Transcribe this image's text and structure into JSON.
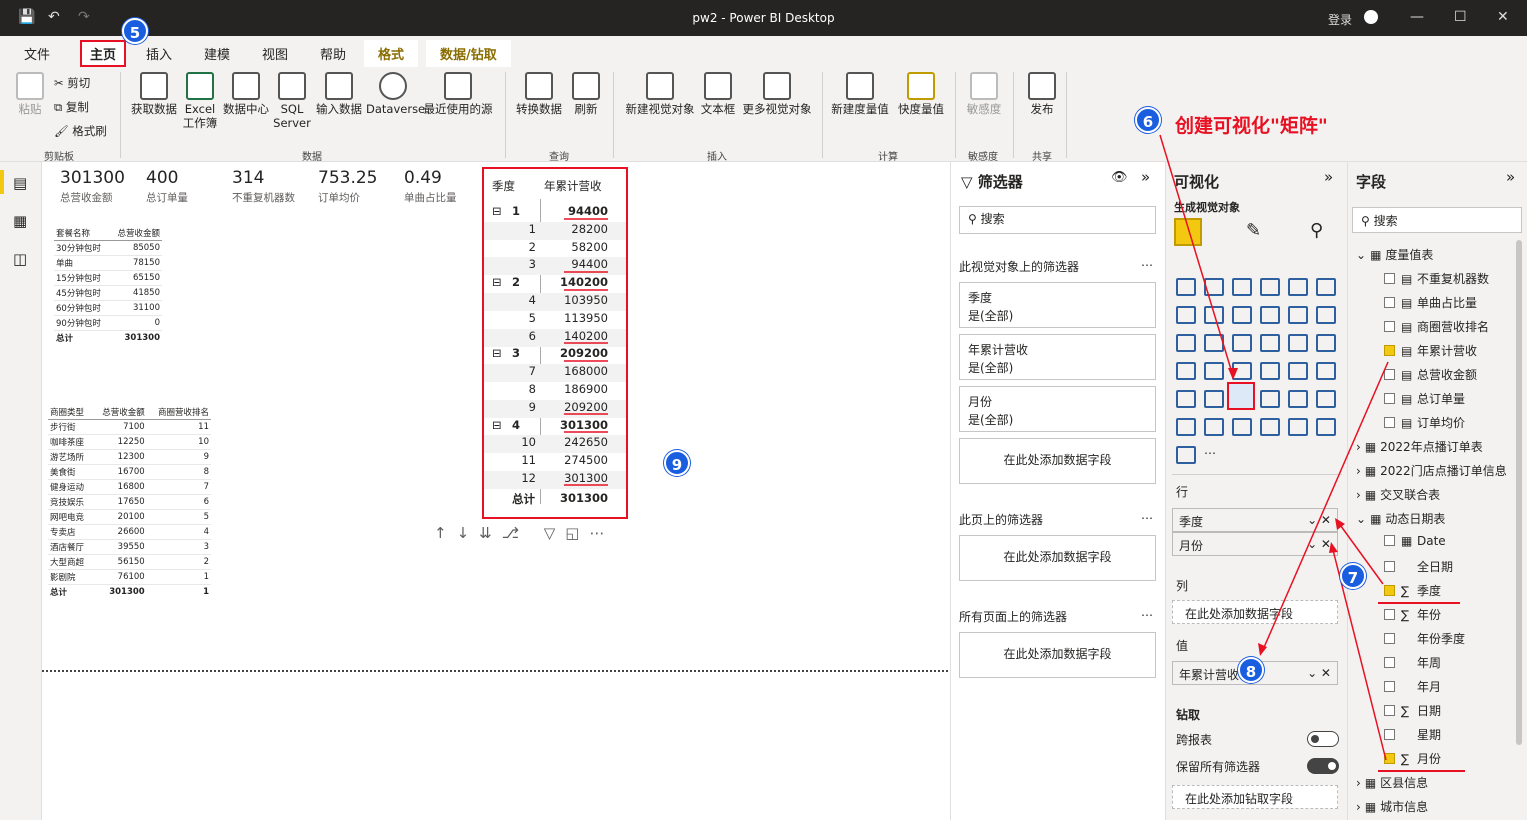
{
  "window": {
    "title": "pw2 - Power BI Desktop",
    "login": "登录"
  },
  "tabs": [
    "文件",
    "主页",
    "插入",
    "建模",
    "视图",
    "帮助",
    "格式",
    "数据/钻取"
  ],
  "ribbon": {
    "clipboard": {
      "paste": "粘贴",
      "cut": "剪切",
      "copy": "复制",
      "format_painter": "格式刷",
      "group": "剪贴板"
    },
    "data": {
      "get_data": "获取数据",
      "excel": "Excel 工作簿",
      "data_hub": "数据中心",
      "sql": "SQL Server",
      "enter_data": "输入数据",
      "dataverse": "Dataverse",
      "recent": "最近使用的源",
      "group": "数据"
    },
    "query": {
      "transform": "转换数据",
      "refresh": "刷新",
      "group": "查询"
    },
    "insert": {
      "new_visual": "新建视觉对象",
      "textbox": "文本框",
      "more_visuals": "更多视觉对象",
      "group": "插入"
    },
    "calc": {
      "new_measure": "新建度量值",
      "quick_measure": "快度量值",
      "group": "计算"
    },
    "sensitivity": {
      "label": "敏感度",
      "group": "敏感度"
    },
    "share": {
      "publish": "发布",
      "group": "共享"
    }
  },
  "cards": [
    {
      "value": "301300",
      "label": "总营收金额"
    },
    {
      "value": "400",
      "label": "总订单量"
    },
    {
      "value": "314",
      "label": "不重复机器数"
    },
    {
      "value": "753.25",
      "label": "订单均价"
    },
    {
      "value": "0.49",
      "label": "单曲占比量"
    }
  ],
  "table1": {
    "headers": [
      "套餐名称",
      "总营收金额"
    ],
    "rows": [
      [
        "30分钟包时",
        "85050"
      ],
      [
        "单曲",
        "78150"
      ],
      [
        "15分钟包时",
        "65150"
      ],
      [
        "45分钟包时",
        "41850"
      ],
      [
        "60分钟包时",
        "31100"
      ],
      [
        "90分钟包时",
        "0"
      ]
    ],
    "total": [
      "总计",
      "301300"
    ]
  },
  "table2": {
    "headers": [
      "商圈类型",
      "总营收金额",
      "商圈营收排名"
    ],
    "rows": [
      [
        "步行街",
        "7100",
        "11"
      ],
      [
        "咖啡茶座",
        "12250",
        "10"
      ],
      [
        "游艺场所",
        "12300",
        "9"
      ],
      [
        "美食街",
        "16700",
        "8"
      ],
      [
        "健身运动",
        "16800",
        "7"
      ],
      [
        "竞技娱乐",
        "17650",
        "6"
      ],
      [
        "网吧电竞",
        "20100",
        "5"
      ],
      [
        "专卖店",
        "26600",
        "4"
      ],
      [
        "酒店餐厅",
        "39550",
        "3"
      ],
      [
        "大型商超",
        "56150",
        "2"
      ],
      [
        "影剧院",
        "76100",
        "1"
      ]
    ],
    "total": [
      "总计",
      "301300",
      "1"
    ]
  },
  "matrix": {
    "headers": [
      "季度",
      "年累计营收"
    ],
    "groups": [
      {
        "q": "1",
        "total": "94400",
        "months": [
          [
            "1",
            "28200"
          ],
          [
            "2",
            "58200"
          ],
          [
            "3",
            "94400"
          ]
        ]
      },
      {
        "q": "2",
        "total": "140200",
        "months": [
          [
            "4",
            "103950"
          ],
          [
            "5",
            "113950"
          ],
          [
            "6",
            "140200"
          ]
        ]
      },
      {
        "q": "3",
        "total": "209200",
        "months": [
          [
            "7",
            "168000"
          ],
          [
            "8",
            "186900"
          ],
          [
            "9",
            "209200"
          ]
        ]
      },
      {
        "q": "4",
        "total": "301300",
        "months": [
          [
            "10",
            "242650"
          ],
          [
            "11",
            "274500"
          ],
          [
            "12",
            "301300"
          ]
        ]
      }
    ],
    "total": [
      "总计",
      "301300"
    ]
  },
  "filters": {
    "title": "筛选器",
    "search": "搜索",
    "on_visual": "此视觉对象上的筛选器",
    "f1": {
      "name": "季度",
      "val": "是(全部)"
    },
    "f2": {
      "name": "年累计营收",
      "val": "是(全部)"
    },
    "f3": {
      "name": "月份",
      "val": "是(全部)"
    },
    "add": "在此处添加数据字段",
    "on_page": "此页上的筛选器",
    "on_all": "所有页面上的筛选器"
  },
  "viz": {
    "title": "可视化",
    "build": "生成视觉对象",
    "rows_label": "行",
    "row1": "季度",
    "row2": "月份",
    "cols_label": "列",
    "cols_add": "在此处添加数据字段",
    "values_label": "值",
    "value1": "年累计营收",
    "drill": "钻取",
    "cross_report": "跨报表",
    "keep_filters": "保留所有筛选器",
    "drill_add": "在此处添加钻取字段"
  },
  "fields": {
    "title": "字段",
    "search": "搜索",
    "items": [
      {
        "t": "度量值表",
        "lvl": 0,
        "kind": "table"
      },
      {
        "t": "不重复机器数",
        "lvl": 1,
        "kind": "m",
        "c": false
      },
      {
        "t": "单曲占比量",
        "lvl": 1,
        "kind": "m",
        "c": false
      },
      {
        "t": "商圈营收排名",
        "lvl": 1,
        "kind": "m",
        "c": false
      },
      {
        "t": "年累计营收",
        "lvl": 1,
        "kind": "m",
        "c": true
      },
      {
        "t": "总营收金额",
        "lvl": 1,
        "kind": "m",
        "c": false
      },
      {
        "t": "总订单量",
        "lvl": 1,
        "kind": "m",
        "c": false
      },
      {
        "t": "订单均价",
        "lvl": 1,
        "kind": "m",
        "c": false
      },
      {
        "t": "2022年点播订单表",
        "lvl": 0,
        "kind": "table"
      },
      {
        "t": "2022门店点播订单信息",
        "lvl": 0,
        "kind": "table"
      },
      {
        "t": "交叉联合表",
        "lvl": 0,
        "kind": "table"
      },
      {
        "t": "动态日期表",
        "lvl": 0,
        "kind": "table"
      },
      {
        "t": "Date",
        "lvl": 1,
        "kind": "d",
        "c": false
      },
      {
        "t": "全日期",
        "lvl": 1,
        "kind": "f",
        "c": false
      },
      {
        "t": "季度",
        "lvl": 1,
        "kind": "s",
        "c": true
      },
      {
        "t": "年份",
        "lvl": 1,
        "kind": "s",
        "c": false
      },
      {
        "t": "年份季度",
        "lvl": 1,
        "kind": "f",
        "c": false
      },
      {
        "t": "年周",
        "lvl": 1,
        "kind": "f",
        "c": false
      },
      {
        "t": "年月",
        "lvl": 1,
        "kind": "f",
        "c": false
      },
      {
        "t": "日期",
        "lvl": 1,
        "kind": "s",
        "c": false
      },
      {
        "t": "星期",
        "lvl": 1,
        "kind": "f",
        "c": false
      },
      {
        "t": "月份",
        "lvl": 1,
        "kind": "s",
        "c": true
      },
      {
        "t": "区县信息",
        "lvl": 0,
        "kind": "table"
      },
      {
        "t": "城市信息",
        "lvl": 0,
        "kind": "table"
      }
    ]
  },
  "annotations": {
    "n5": "5",
    "n6": "6",
    "n7": "7",
    "n8": "8",
    "n9": "9",
    "caption": "创建可视化\"矩阵\""
  }
}
